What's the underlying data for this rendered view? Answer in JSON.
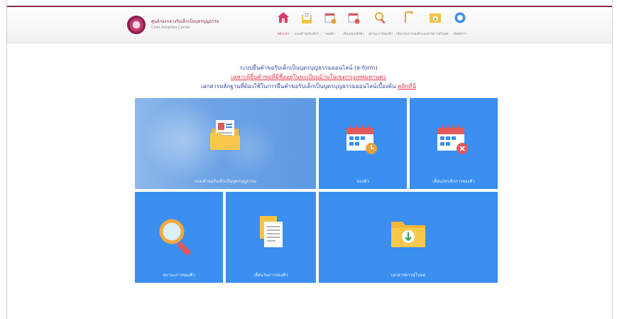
{
  "header": {
    "logo_title": "ศูนย์กองกลางรับเด็กเป็นบุตรบุญธรรม",
    "logo_subtitle": "Child Adoption Center"
  },
  "nav": {
    "items": [
      {
        "label": "หน้าแรก",
        "icon": "home-icon",
        "active": true
      },
      {
        "label": "แบบคำขอรับเด็กฯ",
        "icon": "form-icon",
        "active": false
      },
      {
        "label": "จองคิว",
        "icon": "calendar-clock-icon",
        "active": false
      },
      {
        "label": "เลื่อน/ยกเลิกคิว",
        "icon": "calendar-cancel-icon",
        "active": false
      },
      {
        "label": "สถานะการจองคิว",
        "icon": "search-icon",
        "active": false
      },
      {
        "label": "เลื่อนวันการจองคิว",
        "icon": "door-icon",
        "active": false
      },
      {
        "label": "เอกสารดาวน์โหลด",
        "icon": "download-icon",
        "active": false
      },
      {
        "label": "ติดต่อเรา",
        "icon": "contact-icon",
        "active": false
      }
    ]
  },
  "intro": {
    "line1": "ระบบยื่นคำขอรับเด็กเป็นบุตรบุญธรรมออนไลน์ (e-form)",
    "line2": "เฉพาะผู้ยื่นคำขอที่มีชื่ออยู่ในทะเบียนบ้านในเขตกรุงเทพมหานคร",
    "line3_prefix": "เอกสารหลักฐานที่ต้องใช้ในการยื่นคำขอรับเด็กเป็นบุตรบุญธรรมออนไลน์เบื้องต้น",
    "line3_link": "คลิกที่นี่"
  },
  "tiles": {
    "adoption_form": "แบบคำขอรับเด็กเป็นบุตรบุญธรรม",
    "book_queue": "จองคิว",
    "reschedule_cancel": "เลื่อน/ยกเลิกการจองคิว",
    "queue_status": "สถานะการจองคิว",
    "reschedule_queue": "เลื่อนวันการจองคิว",
    "downloads": "เอกสารดาวน์โหลด"
  },
  "colors": {
    "tile_blue": "#3a8ff1",
    "accent_pink": "#d83f6c",
    "title_blue": "#3a4aa3",
    "link_red": "#e8334a"
  }
}
